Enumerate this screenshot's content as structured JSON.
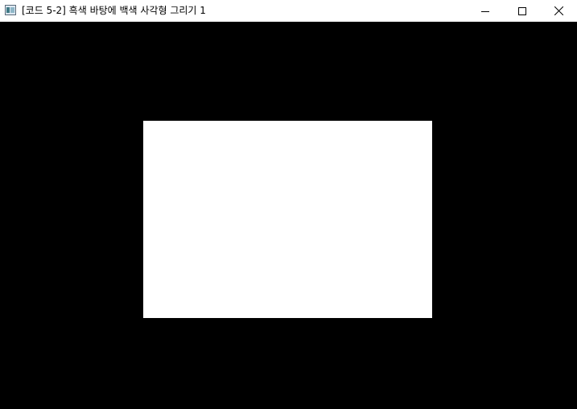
{
  "window": {
    "title": "[코드 5-2] 흑색 바탕에 백색 사각형 그리기 1"
  },
  "titlebar_buttons": {
    "minimize": "minimize-icon",
    "maximize": "maximize-icon",
    "close": "close-icon"
  },
  "canvas": {
    "background_color": "#000000",
    "rectangle_color": "#ffffff"
  }
}
